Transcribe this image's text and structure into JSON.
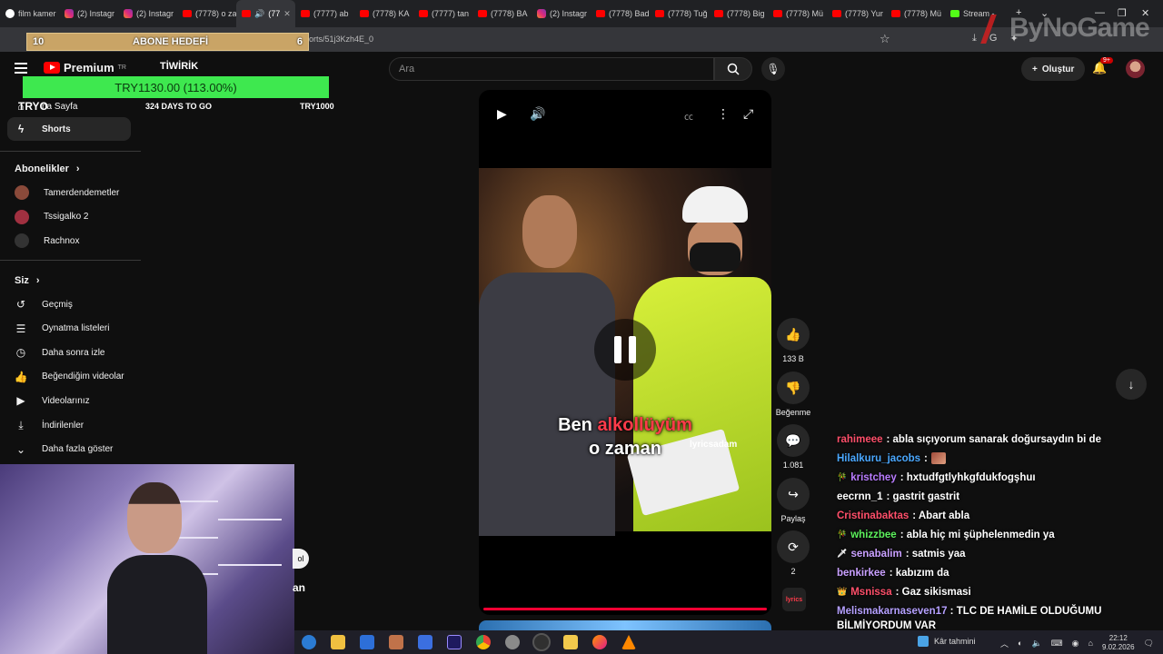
{
  "browser": {
    "tabs": [
      {
        "label": "film kamer",
        "icon": "google"
      },
      {
        "label": "(2) Instagr",
        "icon": "instagram"
      },
      {
        "label": "(2) Instagr",
        "icon": "instagram"
      },
      {
        "label": "(7778) o za",
        "icon": "youtube"
      },
      {
        "label": "(77",
        "icon": "youtube",
        "active": true
      },
      {
        "label": "(7777) ab",
        "icon": "youtube"
      },
      {
        "label": "(7778) KA",
        "icon": "youtube"
      },
      {
        "label": "(7777) tan",
        "icon": "youtube"
      },
      {
        "label": "(7778) BA",
        "icon": "youtube"
      },
      {
        "label": "(2) Instagr",
        "icon": "instagram"
      },
      {
        "label": "(7778) Bad",
        "icon": "youtube"
      },
      {
        "label": "(7778) Tuğ",
        "icon": "youtube"
      },
      {
        "label": "(7778) Big",
        "icon": "youtube"
      },
      {
        "label": "(7778) Mü",
        "icon": "youtube"
      },
      {
        "label": "(7778) Yur",
        "icon": "youtube"
      },
      {
        "label": "(7778) Mü",
        "icon": "youtube"
      },
      {
        "label": "Stream -",
        "icon": "kick"
      }
    ],
    "url": "orts/51j3Kzh4E_0",
    "watermark": "ByNoGame"
  },
  "stream_overlay": {
    "goal_left": "10",
    "goal_title": "ABONE HEDEFİ",
    "goal_right": "6",
    "brand": "TİWİRİK",
    "donation_amount": "TRY1130.00 (113.00%)",
    "donation_progress": 1.13,
    "currency_label": "TRYO",
    "days_to_go": "324 DAYS TO GO",
    "target": "TRY1000"
  },
  "youtube": {
    "logo_text": "Premium",
    "region": "TR",
    "search_placeholder": "Ara",
    "create_label": "Oluştur",
    "notification_count": "9+"
  },
  "sidebar": {
    "home_label": "na Sayfa",
    "shorts_label": "Shorts",
    "subscriptions_header": "Abonelikler",
    "subscriptions": [
      {
        "name": "Tamerdendemetler",
        "color": "#8a4a3a"
      },
      {
        "name": "Tssigalko 2",
        "color": "#a03040"
      },
      {
        "name": "Rachnox",
        "color": "#333333"
      }
    ],
    "you_header": "Siz",
    "you_items": [
      {
        "label": "Geçmiş",
        "icon": "history-icon",
        "glyph": "↺"
      },
      {
        "label": "Oynatma listeleri",
        "icon": "playlist-icon",
        "glyph": "☰"
      },
      {
        "label": "Daha sonra izle",
        "icon": "clock-icon",
        "glyph": "◷"
      },
      {
        "label": "Beğendiğim videolar",
        "icon": "thumb-up-icon",
        "glyph": "👍"
      },
      {
        "label": "Videolarınız",
        "icon": "video-icon",
        "glyph": "▶"
      },
      {
        "label": "İndirilenler",
        "icon": "download-icon",
        "glyph": "⤓"
      },
      {
        "label": "Daha fazla göster",
        "icon": "chevron-down-icon",
        "glyph": "⌄"
      }
    ]
  },
  "player": {
    "caption_word1": "Ben",
    "caption_highlight": "alkollüyüm",
    "caption_line2": "o zaman",
    "video_watermark": "lyricsadam",
    "progress": 1.0
  },
  "actions": {
    "likes": "133 B",
    "dislike_label": "Beğenme",
    "comments": "1.081",
    "share_label": "Paylaş",
    "remix_count": "2",
    "channel_thumb": "lyrics"
  },
  "partial": {
    "button": "ol",
    "text": "an"
  },
  "chat": [
    {
      "user": "rahimeee",
      "color": "#ff4f6a",
      "badge": "",
      "message": ": abla sıçıyorum sanarak doğursaydın bi de"
    },
    {
      "user": "Hilalkuru_jacobs",
      "color": "#4aa8ff",
      "badge": "",
      "message": ":",
      "emote": true
    },
    {
      "user": "kristchey",
      "color": "#b97cff",
      "badge": "🎋",
      "message": ": hxtudfgtlyhkgfdukfogşhuı"
    },
    {
      "user": "eecrnn_1",
      "color": "#ffffff",
      "badge": "",
      "message": ": gastrit gastrit"
    },
    {
      "user": "Cristinabaktas",
      "color": "#ff4f6a",
      "badge": "",
      "message": ": Abart abla"
    },
    {
      "user": "whizzbee",
      "color": "#5cf15c",
      "badge": "🎋",
      "message": ": abla hiç mi şüphelenmedin ya"
    },
    {
      "user": "senabalim",
      "color": "#c9a0ff",
      "badge": "🗡",
      "message": ": satmis yaa"
    },
    {
      "user": "benkirkee",
      "color": "#c9a0ff",
      "badge": "",
      "message": ": kabızım da"
    },
    {
      "user": "Msnissa",
      "color": "#ff4f6a",
      "badge": "👑",
      "message": ": Gaz sikismasi"
    },
    {
      "user": "Melismakarnaseven17",
      "color": "#b5a0ff",
      "badge": "",
      "message": ": TLC DE HAMİLE OLDUĞUMU BİLMİYORDUM VAR",
      "wrap": true
    }
  ],
  "taskbar": {
    "weather": "Kâr tahmini",
    "time": "22:12",
    "date": "9.02.2026"
  },
  "colors": {
    "accent": "#ff0000",
    "goal": "#c9a466",
    "donation": "#3ee84f"
  }
}
